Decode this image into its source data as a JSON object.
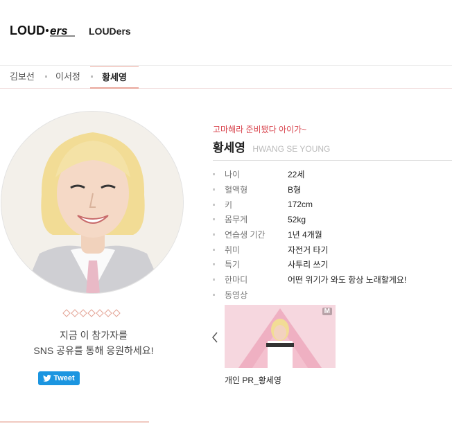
{
  "header": {
    "logo_text": "LOUD·ers",
    "agency_name": "LOUDers"
  },
  "tabs": [
    {
      "label": "김보선"
    },
    {
      "label": "이서정"
    },
    {
      "label": "황세영",
      "active": true
    }
  ],
  "profile": {
    "slogan": "고마해라 준비됐다 아이가~",
    "name_ko": "황세영",
    "name_en": "HWANG SE YOUNG",
    "details": [
      {
        "label": "나이",
        "value": "22세"
      },
      {
        "label": "혈액형",
        "value": "B형"
      },
      {
        "label": "키",
        "value": "172cm"
      },
      {
        "label": "몸무게",
        "value": "52kg"
      },
      {
        "label": "연습생 기간",
        "value": "1년 4개월"
      },
      {
        "label": "취미",
        "value": "자전거 타기"
      },
      {
        "label": "특기",
        "value": "사투리 쓰기"
      },
      {
        "label": "한마디",
        "value": "어떤 위기가 와도 항상 노래할게요!"
      },
      {
        "label": "동영상",
        "value": ""
      }
    ]
  },
  "share": {
    "line1": "지금 이 참가자를",
    "line2": "SNS 공유를 통해 응원하세요!",
    "tweet_label": "Tweet"
  },
  "video": {
    "badge": "M",
    "caption": "개인 PR_황세영"
  },
  "colors": {
    "accent": "#d9464f",
    "tab_underline": "#e9a59a",
    "tweet_blue": "#1b95e0"
  }
}
